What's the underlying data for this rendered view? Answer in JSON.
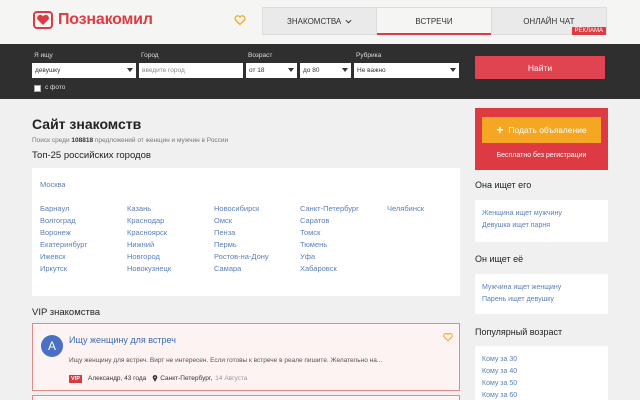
{
  "header": {
    "logo_text": "Познакомил",
    "nav": [
      {
        "label": "ЗНАКОМСТВА"
      },
      {
        "label": "ВСТРЕЧИ"
      },
      {
        "label": "ОНЛАЙН ЧАТ"
      }
    ],
    "ad_badge": "Реклама"
  },
  "search": {
    "seek_label": "Я ищу",
    "seek_value": "девушку",
    "city_label": "Город",
    "city_placeholder": "введите город",
    "age_label": "Возраст",
    "age_from": "от 18",
    "age_to": "до 80",
    "rubric_label": "Рубрика",
    "rubric_value": "Не важно",
    "find_button": "Найти",
    "photo_label": "с фото"
  },
  "main": {
    "title": "Сайт знакомств",
    "sub_prefix": "Поиск среди",
    "sub_count": "108818",
    "sub_suffix": "предложений от женщин и мужчин в России",
    "cities_title": "Топ-25 российских городов",
    "cities": {
      "top": "Москва",
      "col1": [
        "Барнаул",
        "Волгоград",
        "Воронеж",
        "Екатеринбург",
        "Ижевск",
        "Иркутск"
      ],
      "col2": [
        "Казань",
        "Краснодар",
        "Красноярск",
        "Нижний",
        "Новгород",
        "Новокузнецк"
      ],
      "col3": [
        "Новосибирск",
        "Омск",
        "Пенза",
        "Пермь",
        "Ростов-на-Дону",
        "Самара"
      ],
      "col4": [
        "Санкт-Петербург",
        "Саратов",
        "Томск",
        "Тюмень",
        "Уфа",
        "Хабаровск"
      ],
      "col5": [
        "Челябинск"
      ]
    },
    "vip_title": "VIP знакомства",
    "vip_card": {
      "avatar_letter": "А",
      "title": "Ищу женщину для встреч",
      "text": "Ищу женщину для встреч. Вирт не интересен. Если готовы к встрече в реале пишите. Желательно на...",
      "badge": "VIP",
      "author": "Александр, 43 года",
      "city": "Санкт-Петербург,",
      "date": "14 Августа"
    }
  },
  "sidebar": {
    "ad_button": "Подать объявление",
    "ad_note": "Бесплатно без регистрации",
    "she_title": "Она ищет его",
    "she_links": [
      "Женщина ищет мужчину",
      "Девушка ищет парня"
    ],
    "he_title": "Он ищет её",
    "he_links": [
      "Мужчина ищет женщину",
      "Парень ищет девушку"
    ],
    "age_title": "Популярный возраст",
    "age_links": [
      "Кому за 30",
      "Кому за 40",
      "Кому за 50",
      "Кому за 60"
    ]
  },
  "colors": {
    "brand": "#de3a43",
    "accent_orange": "#f5a623",
    "link": "#5b7fb8",
    "dark_bar": "#2f2f2f"
  }
}
